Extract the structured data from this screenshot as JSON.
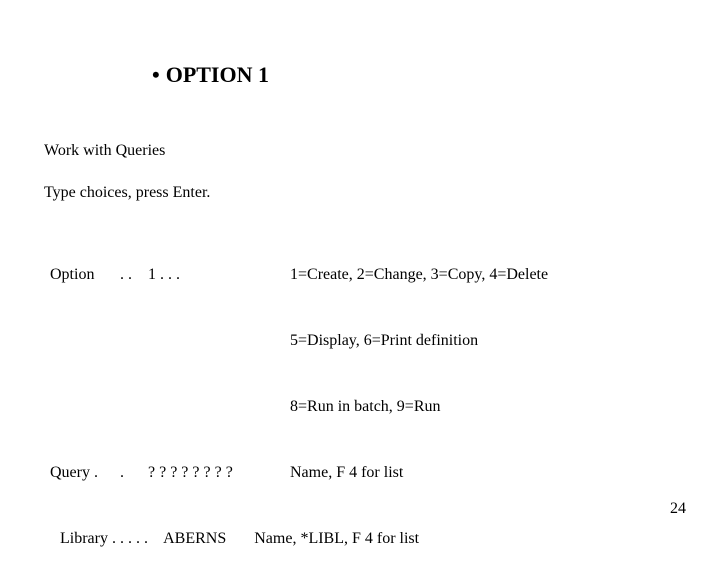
{
  "slide": {
    "title": "OPTION 1",
    "screen_title": "Work with Queries",
    "instruction": "Type choices, press Enter.",
    "page_number": "24"
  },
  "form": {
    "option": {
      "label": "Option",
      "dots": ". .",
      "value": "1 . . .",
      "helps": [
        "1=Create, 2=Change, 3=Copy, 4=Delete",
        "5=Display, 6=Print definition",
        "8=Run in batch, 9=Run"
      ]
    },
    "query": {
      "label": "Query .",
      "dots": ". ",
      "value": "? ? ? ? ? ? ? ?",
      "help": "Name, F 4 for list"
    },
    "library": {
      "label": "Library . . . . .",
      "value": "ABERNS",
      "help": "Name, *LIBL, F 4 for list"
    }
  }
}
